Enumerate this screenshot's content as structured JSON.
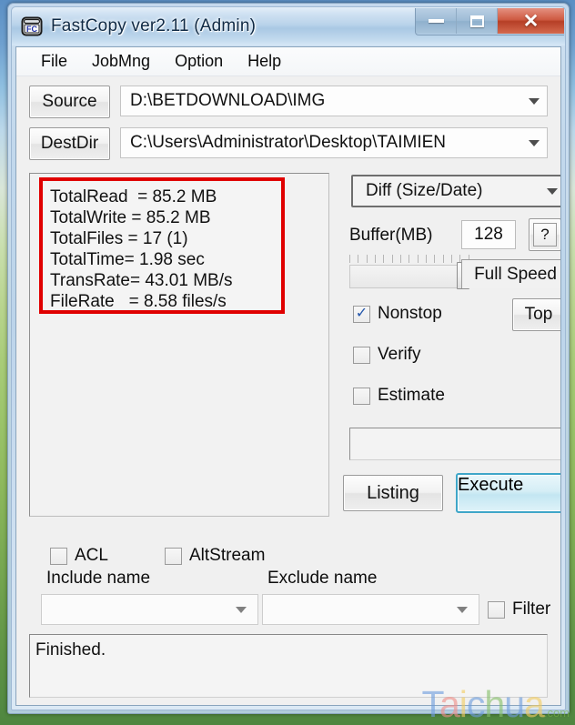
{
  "window": {
    "title": "FastCopy ver2.11 (Admin)",
    "icon": "fastcopy-icon",
    "icon_text": "FC",
    "controls": {
      "minimize": "minimize-icon",
      "maximize": "maximize-icon",
      "close_label": "✕"
    }
  },
  "menubar": {
    "items": [
      {
        "label": "File"
      },
      {
        "label": "JobMng"
      },
      {
        "label": "Option"
      },
      {
        "label": "Help"
      }
    ]
  },
  "paths": {
    "source_label": "Source",
    "source_value": "D:\\BETDOWNLOAD\\IMG",
    "dest_label": "DestDir",
    "dest_value": "C:\\Users\\Administrator\\Desktop\\TAIMIEN"
  },
  "stats": {
    "border_color": "#e00000",
    "lines": [
      "TotalRead  = 85.2 MB",
      "TotalWrite = 85.2 MB",
      "TotalFiles = 17 (1)",
      "TotalTime= 1.98 sec",
      "TransRate= 43.01 MB/s",
      "FileRate   = 8.58 files/s"
    ],
    "values": {
      "total_read": "85.2 MB",
      "total_write": "85.2 MB",
      "total_files": "17 (1)",
      "total_time": "1.98 sec",
      "trans_rate": "43.01 MB/s",
      "file_rate": "8.58 files/s"
    }
  },
  "options": {
    "mode_value": "Diff (Size/Date)",
    "buffer_label": "Buffer(MB)",
    "buffer_value": "128",
    "help_label": "?",
    "speed_text": "Full Speed",
    "nonstop_label": "Nonstop",
    "nonstop_checked": true,
    "verify_label": "Verify",
    "verify_checked": false,
    "estimate_label": "Estimate",
    "estimate_checked": false,
    "top_label": "Top",
    "progress_value": ""
  },
  "actions": {
    "listing_label": "Listing",
    "execute_label": "Execute",
    "execute_accent": "#3ea6c8"
  },
  "filters": {
    "acl_label": "ACL",
    "acl_checked": false,
    "altstream_label": "AltStream",
    "altstream_checked": false,
    "include_label": "Include name",
    "include_value": "",
    "exclude_label": "Exclude name",
    "exclude_value": "",
    "filter_label": "Filter",
    "filter_checked": false
  },
  "log": {
    "text": "Finished."
  },
  "watermark": {
    "letters": [
      {
        "ch": "T",
        "color": "#6f9ede"
      },
      {
        "ch": "a",
        "color": "#f0908a"
      },
      {
        "ch": "i",
        "color": "#f3cd62"
      },
      {
        "ch": "c",
        "color": "#6f9ede"
      },
      {
        "ch": "h",
        "color": "#86c06a"
      },
      {
        "ch": "u",
        "color": "#6f9ede"
      },
      {
        "ch": "a",
        "color": "#f3cd62"
      }
    ],
    "suffix": ".com"
  }
}
